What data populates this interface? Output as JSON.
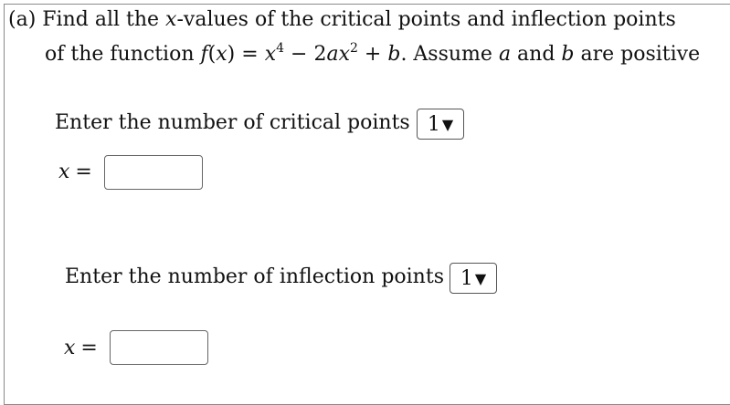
{
  "question": {
    "part": "(a)",
    "line1_prefix": "Find all the ",
    "var_x": "x",
    "line1_suffix": "-values of the critical points and inflection points",
    "line2_prefix": "of the function ",
    "func_f": "f",
    "func_arg_open": "(",
    "func_arg_close": ")",
    "eq": " = ",
    "term1_base": "x",
    "term1_exp": "4",
    "minus": " − 2",
    "term2_a": "a",
    "term2_x": "x",
    "term2_exp": "2",
    "plus": " + ",
    "term3_b": "b",
    "line2_mid": ". Assume ",
    "assume_a": "a",
    "and": " and ",
    "assume_b": "b",
    "line2_suffix": " are positive"
  },
  "critical": {
    "label": "Enter the number of critical points",
    "selected": "1",
    "x_label": "x",
    "eq_sign": "=",
    "input_value": ""
  },
  "inflection": {
    "label": "Enter the number of inflection points",
    "selected": "1",
    "x_label": "x",
    "eq_sign": "=",
    "input_value": ""
  },
  "icons": {
    "dropdown": "caret-down-icon"
  },
  "colors": {
    "border": "#555555",
    "text": "#111111"
  }
}
